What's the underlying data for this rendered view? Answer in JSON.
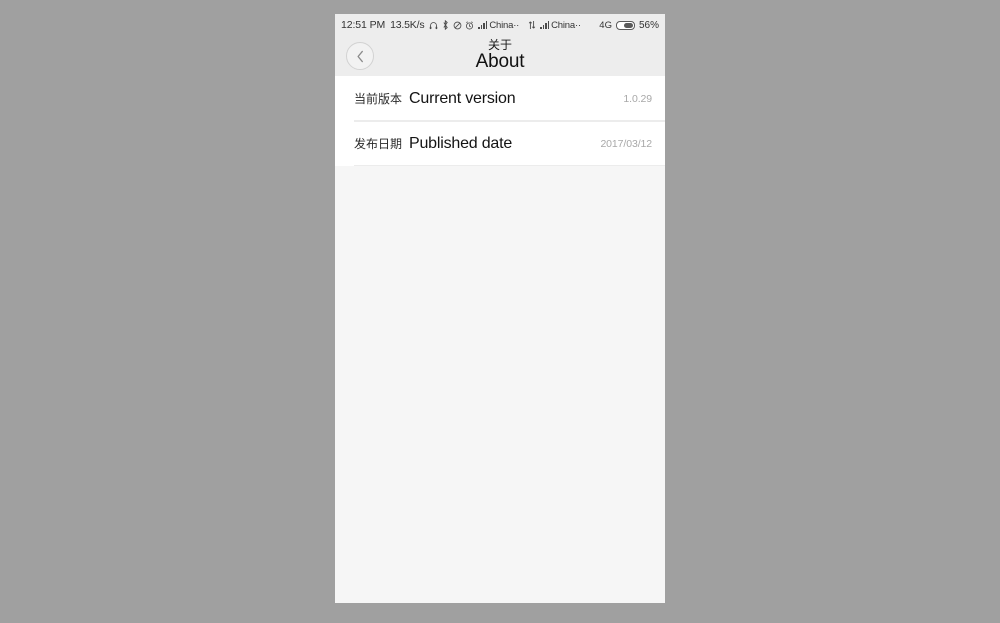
{
  "status_bar": {
    "time": "12:51 PM",
    "data_rate": "13.5K/s",
    "icons": [
      "headphone-icon",
      "bluetooth-icon",
      "mute-icon",
      "alarm-clock-icon"
    ],
    "carrier_1": "China··",
    "carrier_2": "China··",
    "network_type": "4G",
    "battery_percent": "56%"
  },
  "nav": {
    "back_icon": "chevron-left-icon",
    "title_cn": "关于",
    "title_en": "About"
  },
  "list": {
    "rows": [
      {
        "label_cn": "当前版本",
        "label_en": "Current version",
        "value": "1.0.29"
      },
      {
        "label_cn": "发布日期",
        "label_en": "Published date",
        "value": "2017/03/12"
      }
    ]
  },
  "colors": {
    "page_background": "#a0a0a0",
    "screen_background": "#f6f6f6",
    "header_background": "#ededed",
    "row_background": "#ffffff",
    "value_text": "#a8a8a8",
    "divider": "#ececec"
  }
}
